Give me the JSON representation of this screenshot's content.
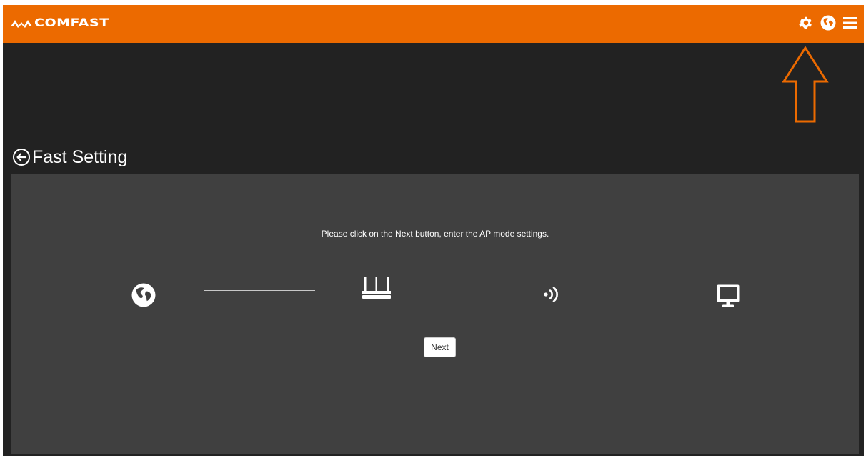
{
  "header": {
    "brand": "COMFAST",
    "accent_color": "#ec6a00",
    "icons": [
      "gear-icon",
      "globe-icon",
      "menu-icon"
    ]
  },
  "annotation": {
    "arrow_color": "#ec6a00",
    "points_to": "gear-icon"
  },
  "page": {
    "title": "Fast Setting",
    "back_icon": "circle-arrow-left-icon"
  },
  "wizard": {
    "instruction": "Please click on the Next button, enter the AP mode settings.",
    "diagram_icons": [
      "globe-icon",
      "router-icon",
      "wireless-signal-icon",
      "monitor-icon"
    ],
    "next_label": "Next"
  }
}
